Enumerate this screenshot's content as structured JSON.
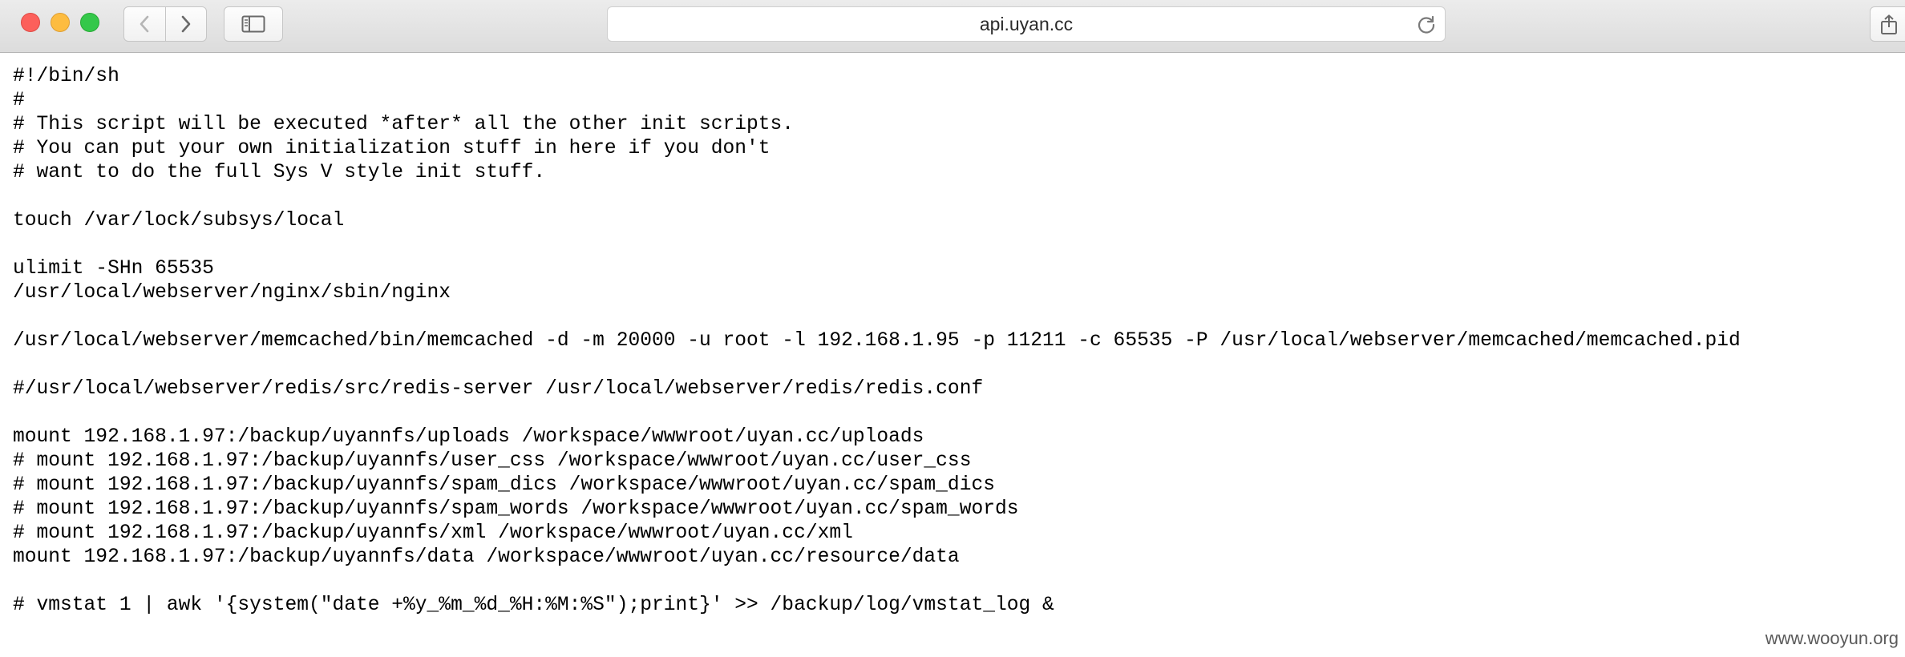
{
  "browser": {
    "url": "api.uyan.cc",
    "icons": {
      "back": "chevron-left-icon",
      "forward": "chevron-right-icon",
      "sidebar": "sidebar-icon",
      "reload": "reload-icon",
      "share": "share-icon"
    },
    "colors": {
      "close": "#fc605b",
      "minimize": "#fdbc40",
      "zoom": "#34c84a"
    }
  },
  "file": {
    "lines": [
      "#!/bin/sh",
      "#",
      "# This script will be executed *after* all the other init scripts.",
      "# You can put your own initialization stuff in here if you don't",
      "# want to do the full Sys V style init stuff.",
      "",
      "touch /var/lock/subsys/local",
      "",
      "ulimit -SHn 65535",
      "/usr/local/webserver/nginx/sbin/nginx",
      "",
      "/usr/local/webserver/memcached/bin/memcached -d -m 20000 -u root -l 192.168.1.95 -p 11211 -c 65535 -P /usr/local/webserver/memcached/memcached.pid",
      "",
      "#/usr/local/webserver/redis/src/redis-server /usr/local/webserver/redis/redis.conf",
      "",
      "mount 192.168.1.97:/backup/uyannfs/uploads /workspace/wwwroot/uyan.cc/uploads",
      "# mount 192.168.1.97:/backup/uyannfs/user_css /workspace/wwwroot/uyan.cc/user_css",
      "# mount 192.168.1.97:/backup/uyannfs/spam_dics /workspace/wwwroot/uyan.cc/spam_dics",
      "# mount 192.168.1.97:/backup/uyannfs/spam_words /workspace/wwwroot/uyan.cc/spam_words",
      "# mount 192.168.1.97:/backup/uyannfs/xml /workspace/wwwroot/uyan.cc/xml",
      "mount 192.168.1.97:/backup/uyannfs/data /workspace/wwwroot/uyan.cc/resource/data",
      "",
      "# vmstat 1 | awk '{system(\"date +%y_%m_%d_%H:%M:%S\");print}' >> /backup/log/vmstat_log &"
    ]
  },
  "watermark": "www.wooyun.org"
}
